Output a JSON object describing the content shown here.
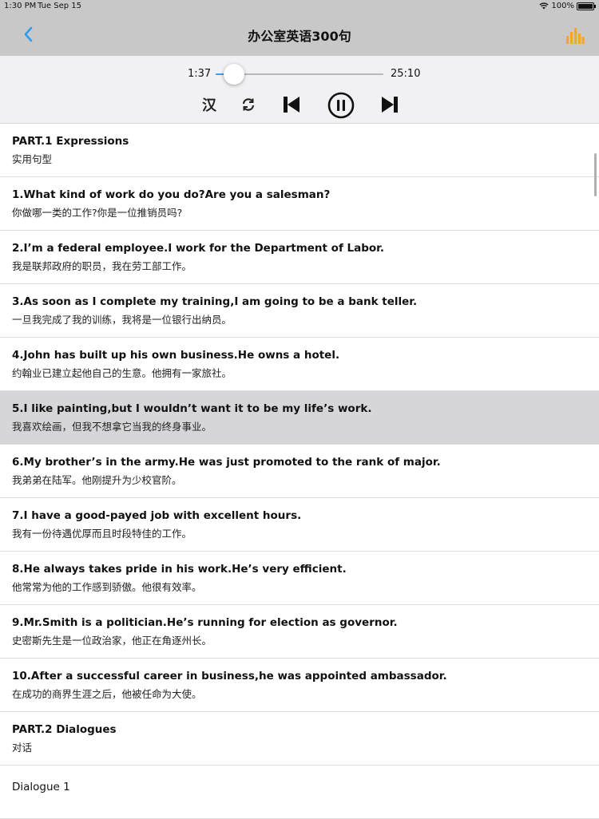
{
  "status": {
    "time": "1:30 PM",
    "date": "Tue Sep 15",
    "battery": "100%"
  },
  "nav": {
    "title": "办公室英语300句",
    "back_icon": "chevron-left-icon",
    "right_icon": "bar-chart-icon",
    "accent": "#2f9cf0",
    "chart_color": "#f5a623"
  },
  "player": {
    "elapsed": "1:37",
    "total": "25:10",
    "progress": 0.064,
    "translate_label": "汉",
    "icons": [
      "repeat-icon",
      "previous-icon",
      "pause-icon",
      "next-icon"
    ]
  },
  "items": [
    {
      "en": "PART.1 Expressions",
      "zh": "实用句型"
    },
    {
      "en": "1.What kind of work do you do?Are you a salesman?",
      "zh": "你做哪一类的工作?你是一位推销员吗?"
    },
    {
      "en": "2.I’m a federal employee.I work for the Department of Labor.",
      "zh": "我是联邦政府的职员，我在劳工部工作。"
    },
    {
      "en": "3.As soon as I complete my training,I am going to be a bank teller.",
      "zh": "一旦我完成了我的训练，我将是一位银行出纳员。"
    },
    {
      "en": "4.John has built up his own business.He owns a hotel.",
      "zh": "约翰业已建立起他自己的生意。他拥有一家旅社。"
    },
    {
      "en": "5.I like painting,but I wouldn’t want it to be my life’s work.",
      "zh": "我喜欢绘画，但我不想拿它当我的终身事业。"
    },
    {
      "en": "6.My brother’s in the army.He was just promoted to the rank of major.",
      "zh": "我弟弟在陆军。他刚提升为少校官阶。"
    },
    {
      "en": "7.I have a good-payed job with excellent hours.",
      "zh": "我有一份待遇优厚而且时段特佳的工作。"
    },
    {
      "en": "8.He always takes pride in his work.He’s very efficient.",
      "zh": "他常常为他的工作感到骄傲。他很有效率。"
    },
    {
      "en": "9.Mr.Smith is a politician.He’s running for election as governor.",
      "zh": "史密斯先生是一位政治家，他正在角逐州长。"
    },
    {
      "en": "10.After a successful career in business,he was appointed ambassador.",
      "zh": "在成功的商界生涯之后，他被任命为大使。"
    },
    {
      "en": "PART.2 Dialogues",
      "zh": "对话"
    },
    {
      "en": "Dialogue 1",
      "zh": ""
    }
  ],
  "selected_index": 5
}
